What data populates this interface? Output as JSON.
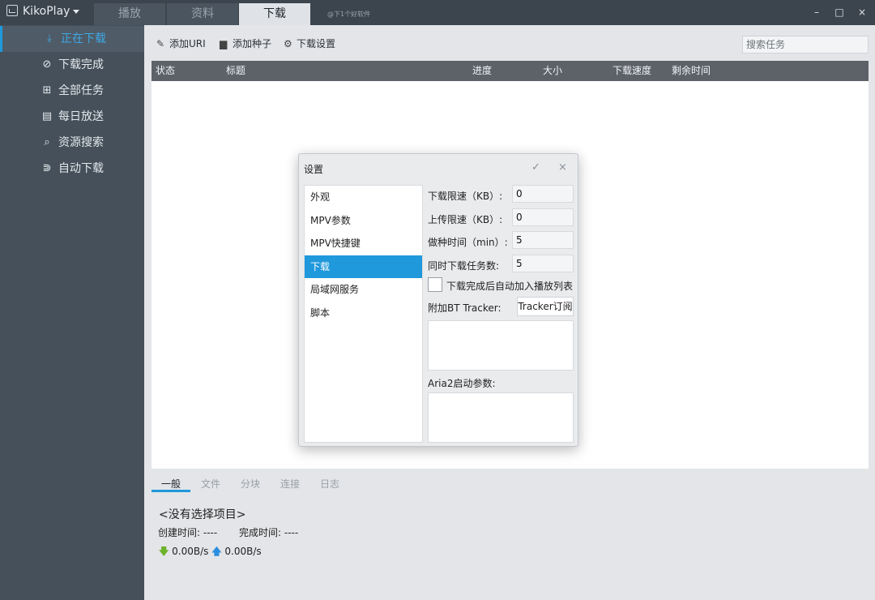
{
  "app": {
    "title": "KikoPlay",
    "watermark": "@下1个好软件"
  },
  "nav_tabs": [
    {
      "label": "播放"
    },
    {
      "label": "资料"
    },
    {
      "label": "下载",
      "active": true
    }
  ],
  "window_controls": {
    "minimize": "–",
    "maximize": "□",
    "close": "×"
  },
  "sidebar": {
    "items": [
      {
        "label": "正在下载",
        "icon": "download-icon",
        "glyph": "⤓",
        "active": true
      },
      {
        "label": "下载完成",
        "icon": "check-circle-icon",
        "glyph": "⊘"
      },
      {
        "label": "全部任务",
        "icon": "grid-icon",
        "glyph": "⊞"
      },
      {
        "label": "每日放送",
        "icon": "calendar-icon",
        "glyph": "▤"
      },
      {
        "label": "资源搜索",
        "icon": "search-icon",
        "glyph": "⌕"
      },
      {
        "label": "自动下载",
        "icon": "rss-icon",
        "glyph": "⋑"
      }
    ]
  },
  "toolbar": {
    "add_uri": "添加URI",
    "add_torrent": "添加种子",
    "download_settings": "下载设置",
    "search_placeholder": "搜索任务"
  },
  "table": {
    "columns": [
      "状态",
      "标题",
      "进度",
      "大小",
      "下载速度",
      "剩余时间"
    ]
  },
  "detail": {
    "tabs": [
      "一般",
      "文件",
      "分块",
      "连接",
      "日志"
    ],
    "no_selection": "<没有选择项目>",
    "created_label": "创建时间: ----",
    "finished_label": "完成时间: ----",
    "download_speed": "0.00B/s",
    "upload_speed": "0.00B/s"
  },
  "dialog": {
    "title": "设置",
    "confirm": "✓",
    "close": "×",
    "categories": [
      "外观",
      "MPV参数",
      "MPV快捷键",
      "下载",
      "局域网服务",
      "脚本"
    ],
    "active_category": "下载",
    "fields": {
      "download_limit_label": "下载限速（KB）:",
      "download_limit_value": "0",
      "upload_limit_label": "上传限速（KB）:",
      "upload_limit_value": "0",
      "seed_time_label": "做种时间（min）:",
      "seed_time_value": "5",
      "concurrent_label": "同时下载任务数:",
      "concurrent_value": "5",
      "auto_add_label": "下载完成后自动加入播放列表",
      "auto_add_checked": false,
      "bt_tracker_label": "附加BT Tracker:",
      "tracker_sub_button": "Tracker订阅",
      "aria2_label": "Aria2启动参数:"
    }
  }
}
